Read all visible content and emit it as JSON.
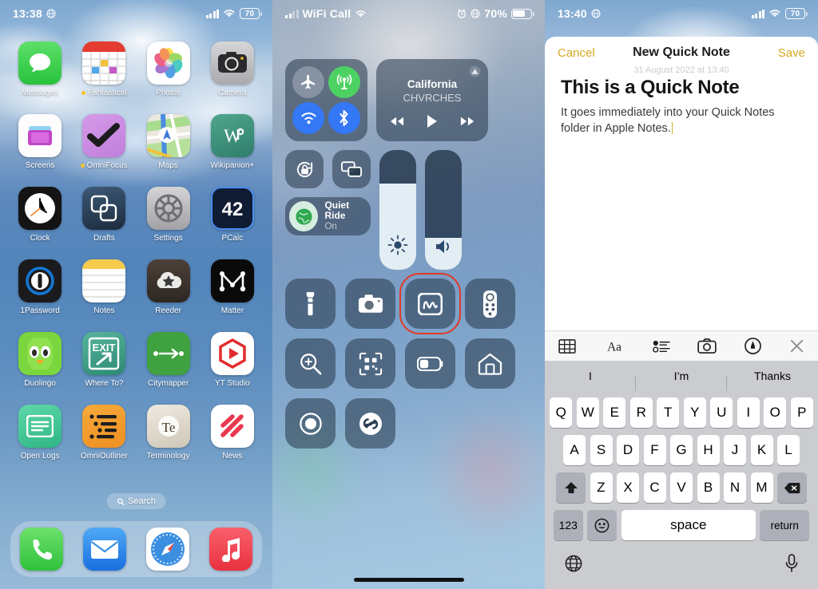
{
  "panels": {
    "home": {
      "status": {
        "time": "13:38",
        "location_icon": "globe-icon",
        "battery": "70"
      },
      "apps": [
        {
          "label": "Messages",
          "icon": "messages-icon",
          "badge": false
        },
        {
          "label": "Fantastical",
          "icon": "fantastical-icon",
          "badge": true
        },
        {
          "label": "Photos",
          "icon": "photos-icon",
          "badge": false
        },
        {
          "label": "Camera",
          "icon": "camera-icon",
          "badge": false
        },
        {
          "label": "Screens",
          "icon": "screens-icon",
          "badge": false
        },
        {
          "label": "OmniFocus",
          "icon": "omnifocus-icon",
          "badge": true
        },
        {
          "label": "Maps",
          "icon": "maps-icon",
          "badge": false
        },
        {
          "label": "Wikipanion+",
          "icon": "wikipanion-icon",
          "badge": false
        },
        {
          "label": "Clock",
          "icon": "clock-icon",
          "badge": false
        },
        {
          "label": "Drafts",
          "icon": "drafts-icon",
          "badge": false
        },
        {
          "label": "Settings",
          "icon": "settings-icon",
          "badge": false
        },
        {
          "label": "PCalc",
          "icon": "pcalc-icon",
          "badge": false
        },
        {
          "label": "1Password",
          "icon": "1password-icon",
          "badge": false
        },
        {
          "label": "Notes",
          "icon": "notes-icon",
          "badge": false
        },
        {
          "label": "Reeder",
          "icon": "reeder-icon",
          "badge": false
        },
        {
          "label": "Matter",
          "icon": "matter-icon",
          "badge": false
        },
        {
          "label": "Duolingo",
          "icon": "duolingo-icon",
          "badge": false
        },
        {
          "label": "Where To?",
          "icon": "whereto-icon",
          "badge": false
        },
        {
          "label": "Citymapper",
          "icon": "citymapper-icon",
          "badge": false
        },
        {
          "label": "YT Studio",
          "icon": "ytstudio-icon",
          "badge": false
        },
        {
          "label": "Open Logs",
          "icon": "openlogs-icon",
          "badge": false
        },
        {
          "label": "OmniOutliner",
          "icon": "omnioutliner-icon",
          "badge": false
        },
        {
          "label": "Terminology",
          "icon": "terminology-icon",
          "badge": false
        },
        {
          "label": "News",
          "icon": "news-icon",
          "badge": false
        }
      ],
      "search_pill": "Search",
      "dock": [
        {
          "label": "Phone",
          "icon": "phone-icon"
        },
        {
          "label": "Mail",
          "icon": "mail-icon"
        },
        {
          "label": "Safari",
          "icon": "safari-icon"
        },
        {
          "label": "Music",
          "icon": "music-icon"
        }
      ]
    },
    "control_center": {
      "status": {
        "carrier": "WiFi Call",
        "battery_percent": "70%",
        "alarm_icon": "alarm-icon",
        "location_icon": "globe-icon"
      },
      "connectivity": [
        {
          "name": "Airplane Mode",
          "icon": "airplane-icon",
          "state": "off"
        },
        {
          "name": "Cellular Data",
          "icon": "cellular-icon",
          "state": "on"
        },
        {
          "name": "Wi-Fi",
          "icon": "wifi-icon",
          "state": "on"
        },
        {
          "name": "Bluetooth",
          "icon": "bluetooth-icon",
          "state": "on"
        }
      ],
      "now_playing": {
        "title": "California",
        "artist": "CHVRCHES",
        "airplay_icon": "airplay-icon",
        "controls": [
          "rewind-icon",
          "play-icon",
          "fast-forward-icon"
        ]
      },
      "rotation_lock": {
        "name": "Rotation Lock",
        "icon": "rotation-lock-icon"
      },
      "screen_mirroring": {
        "name": "Screen Mirroring",
        "icon": "screen-mirroring-icon"
      },
      "focus": {
        "title": "Quiet Ride",
        "subtitle": "On",
        "icon": "focus-globe-icon"
      },
      "brightness": {
        "name": "Brightness",
        "icon": "brightness-icon",
        "value": 72
      },
      "volume": {
        "name": "Volume",
        "icon": "volume-icon",
        "value": 27
      },
      "tiles": [
        {
          "name": "Flashlight",
          "icon": "flashlight-icon",
          "highlighted": false
        },
        {
          "name": "Camera",
          "icon": "camera-icon",
          "highlighted": false
        },
        {
          "name": "Quick Note",
          "icon": "quick-note-icon",
          "highlighted": true
        },
        {
          "name": "Apple TV Remote",
          "icon": "tv-remote-icon",
          "highlighted": false
        },
        {
          "name": "Magnifier",
          "icon": "magnifier-icon",
          "highlighted": false
        },
        {
          "name": "Code Scanner",
          "icon": "qr-scanner-icon",
          "highlighted": false
        },
        {
          "name": "Low Power Mode",
          "icon": "low-power-icon",
          "highlighted": false
        },
        {
          "name": "Home",
          "icon": "home-icon",
          "highlighted": false
        },
        {
          "name": "Screen Recording",
          "icon": "screen-record-icon",
          "highlighted": false
        },
        {
          "name": "Shazam",
          "icon": "shazam-icon",
          "highlighted": false
        }
      ]
    },
    "quick_note": {
      "status": {
        "time": "13:40",
        "location_icon": "globe-icon",
        "battery": "70"
      },
      "nav": {
        "cancel": "Cancel",
        "title": "New Quick Note",
        "save": "Save"
      },
      "note": {
        "date": "31 August 2022 at 13:40",
        "heading": "This is a Quick Note",
        "body": "It goes immediately into your Quick Notes folder in Apple Notes."
      },
      "toolbar": [
        {
          "name": "table-icon"
        },
        {
          "name": "format-aa-icon",
          "label": "Aa"
        },
        {
          "name": "checklist-icon"
        },
        {
          "name": "camera-icon"
        },
        {
          "name": "markup-pen-icon"
        },
        {
          "name": "close-icon"
        }
      ],
      "predictions": [
        "I",
        "I’m",
        "Thanks"
      ],
      "keyboard": {
        "row1": [
          "Q",
          "W",
          "E",
          "R",
          "T",
          "Y",
          "U",
          "I",
          "O",
          "P"
        ],
        "row2": [
          "A",
          "S",
          "D",
          "F",
          "G",
          "H",
          "J",
          "K",
          "L"
        ],
        "row3": [
          "Z",
          "X",
          "C",
          "V",
          "B",
          "N",
          "M"
        ],
        "shift": "shift-icon",
        "backspace": "backspace-icon",
        "numbers": "123",
        "emoji": "emoji-icon",
        "space": "space",
        "return": "return",
        "globe": "globe-keyboard-icon",
        "dictation": "microphone-icon"
      }
    }
  },
  "accent_colors": {
    "highlight_box": "#e03a26",
    "notes_yellow": "#d6a921",
    "ios_blue": "#3478f6",
    "ios_green": "#4cd262"
  }
}
